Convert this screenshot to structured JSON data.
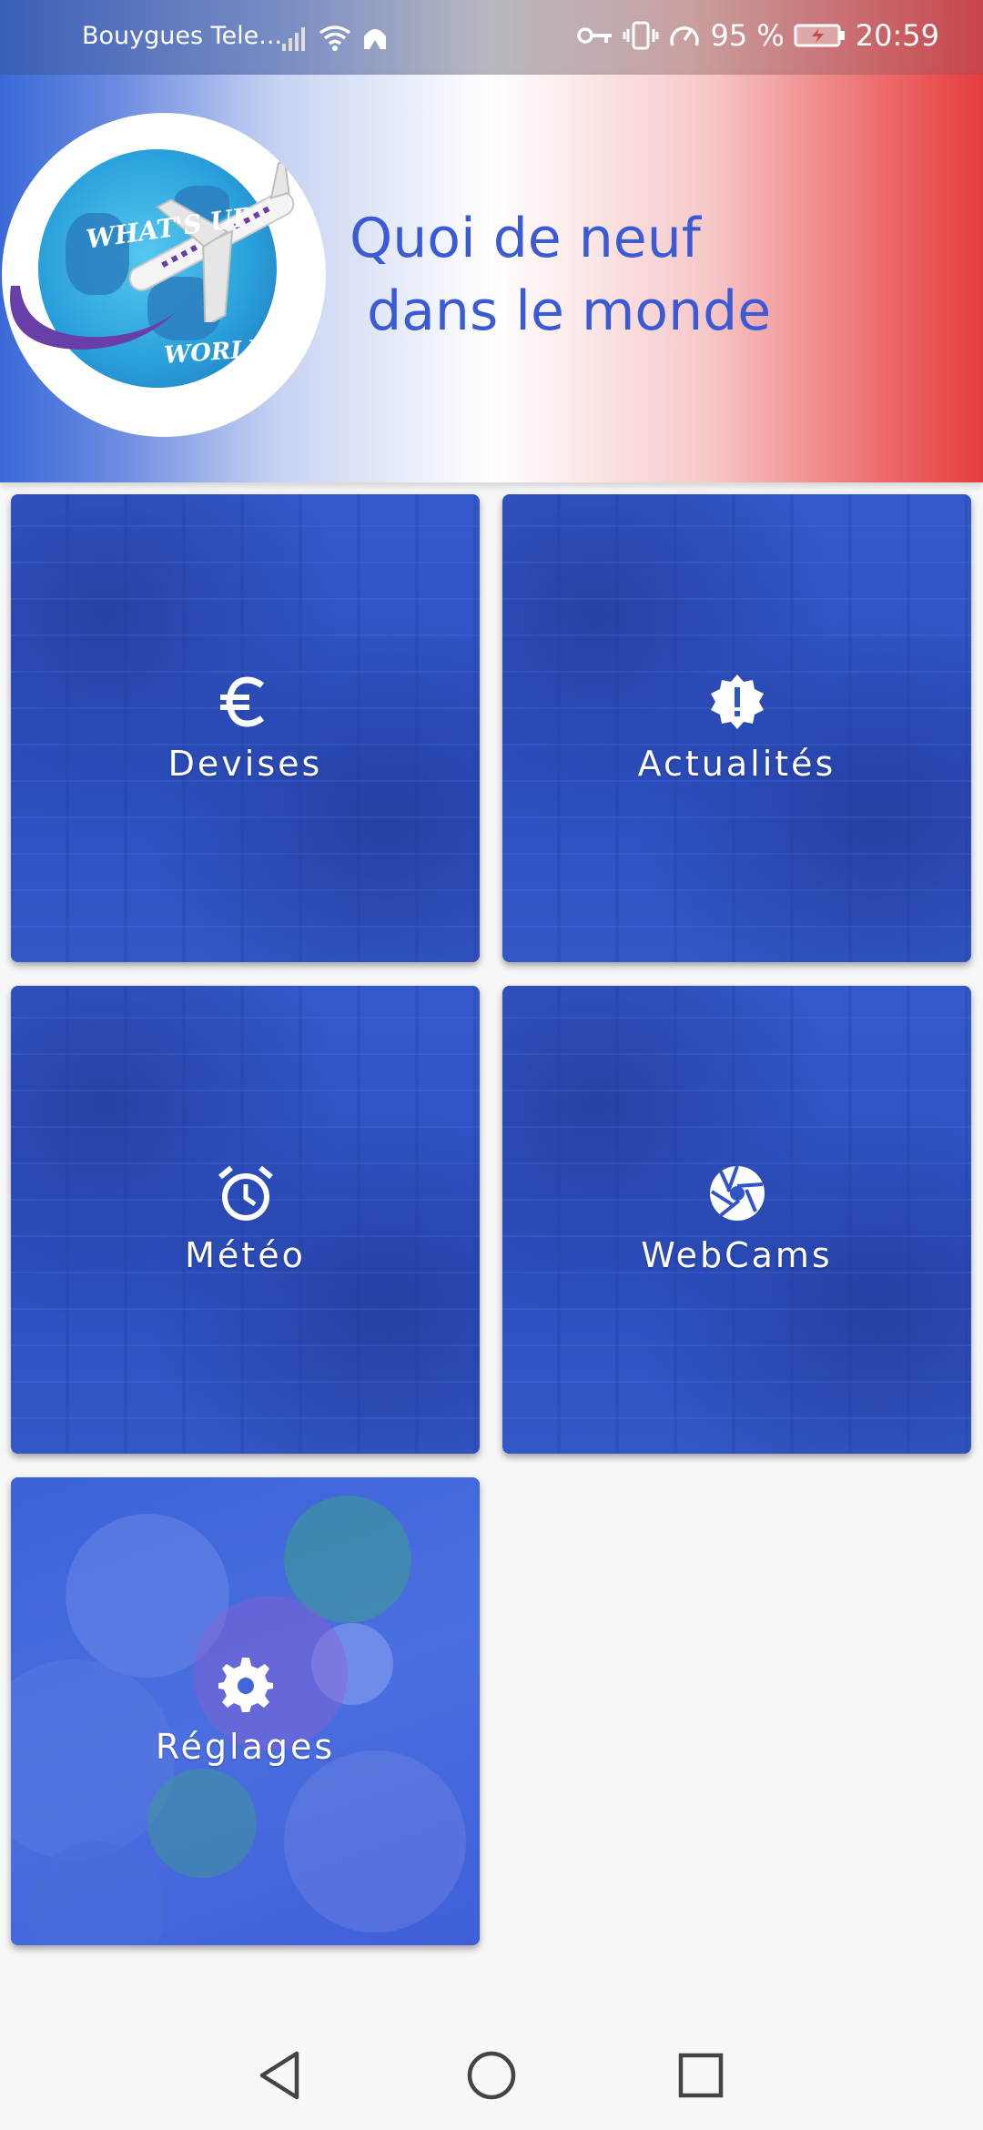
{
  "status_bar": {
    "carrier": "Bouygues Tele...",
    "battery": "95 %",
    "time": "20:59"
  },
  "header": {
    "logo_text_top": "WHAT'S UP",
    "logo_text_bottom": "WORLD",
    "title": "Quoi de neuf\n dans le monde"
  },
  "tiles": [
    {
      "label": "Devises",
      "icon": "euro-icon"
    },
    {
      "label": "Actualités",
      "icon": "alert-badge-icon"
    },
    {
      "label": "Météo",
      "icon": "alarm-clock-icon"
    },
    {
      "label": "WebCams",
      "icon": "camera-aperture-icon"
    },
    {
      "label": "Réglages",
      "icon": "gear-icon"
    }
  ],
  "colors": {
    "title": "#3b5bd6",
    "tile": "#2f55c6"
  }
}
